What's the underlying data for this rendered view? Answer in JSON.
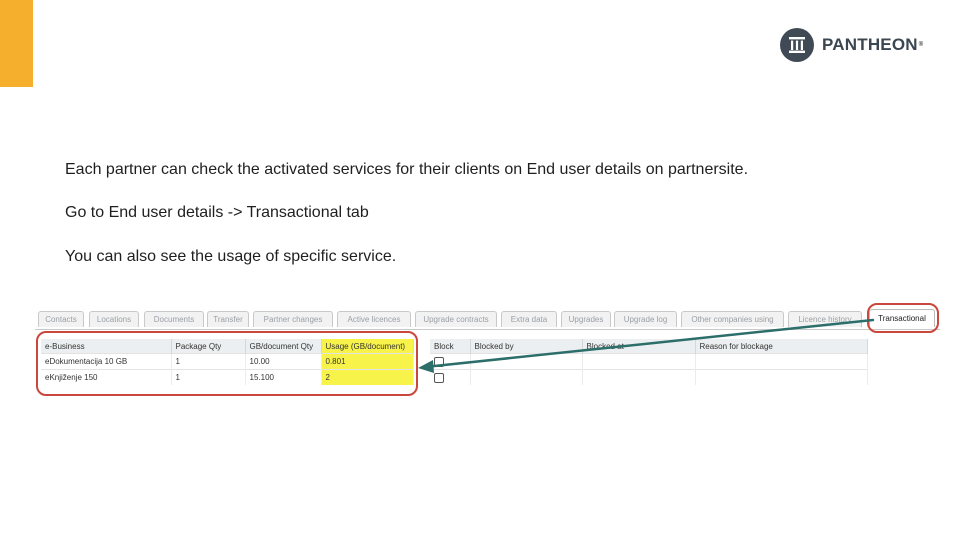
{
  "brand": {
    "name": "PANTHEON",
    "tm": "®",
    "accent_color": "#f6ae2d",
    "logo_color": "#3f4a55"
  },
  "paragraphs": [
    "Each partner can check the activated services for their clients on End user details on partnersite.",
    "Go to End user details -> Transactional tab",
    "You can also see the usage of specific service."
  ],
  "screenshot": {
    "tabs": [
      {
        "label": "Contacts",
        "active": false
      },
      {
        "label": "Locations",
        "active": false
      },
      {
        "label": "Documents",
        "active": false
      },
      {
        "label": "Transfer",
        "active": false
      },
      {
        "label": "Partner changes",
        "active": false
      },
      {
        "label": "Active licences",
        "active": false
      },
      {
        "label": "Upgrade contracts",
        "active": false
      },
      {
        "label": "Extra data",
        "active": false
      },
      {
        "label": "Upgrades",
        "active": false
      },
      {
        "label": "Upgrade log",
        "active": false
      },
      {
        "label": "Other companies using",
        "active": false
      },
      {
        "label": "Licence history",
        "active": false
      },
      {
        "label": "Transactional",
        "active": true
      }
    ],
    "services_table": {
      "headers": [
        "e-Business",
        "Package Qty",
        "GB/document Qty",
        "Usage (GB/document)"
      ],
      "rows": [
        [
          "eDokumentacija 10 GB",
          "1",
          "10.00",
          "0.801"
        ],
        [
          "eKnjiženje 150",
          "1",
          "15.100",
          "2"
        ]
      ]
    },
    "block_table": {
      "headers": [
        "Block",
        "Blocked by",
        "Blocked at",
        "Reason for blockage"
      ]
    },
    "highlight_color": "#f8f34a",
    "ring_color": "#c9473c",
    "arrow_color": "#2c6e6a"
  }
}
